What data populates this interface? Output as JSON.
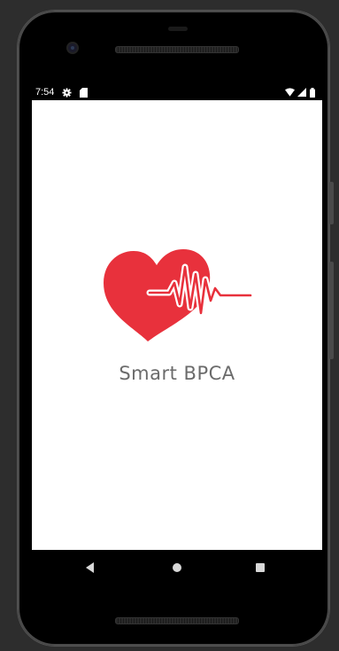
{
  "status_bar": {
    "time": "7:54",
    "left_icons": [
      "gear-icon",
      "sd-card-icon"
    ],
    "right_icons": [
      "wifi-icon",
      "signal-icon",
      "battery-icon"
    ]
  },
  "splash": {
    "app_name": "Smart BPCA",
    "logo": "heart-pulse-logo",
    "accent_color": "#e8313c"
  },
  "nav_bar": {
    "buttons": [
      "back-icon",
      "home-icon",
      "recents-icon"
    ]
  }
}
